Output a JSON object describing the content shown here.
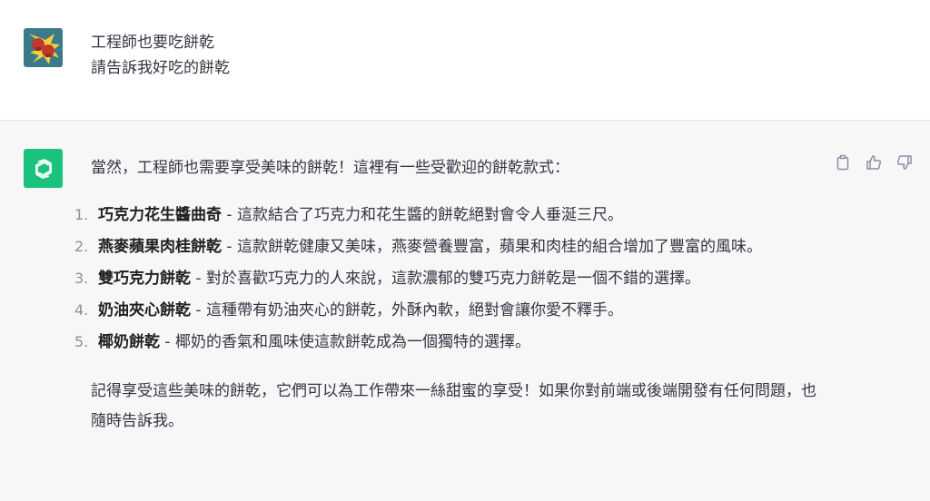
{
  "user_message": {
    "lines": [
      "工程師也要吃餅乾",
      "請告訴我好吃的餅乾"
    ]
  },
  "assistant_message": {
    "intro": "當然，工程師也需要享受美味的餅乾！這裡有一些受歡迎的餅乾款式：",
    "items": [
      {
        "num": "1.",
        "name": "巧克力花生醬曲奇",
        "desc": " - 這款結合了巧克力和花生醬的餅乾絕對會令人垂涎三尺。"
      },
      {
        "num": "2.",
        "name": "燕麥蘋果肉桂餅乾",
        "desc": " - 這款餅乾健康又美味，燕麥營養豐富，蘋果和肉桂的組合增加了豐富的風味。"
      },
      {
        "num": "3.",
        "name": "雙巧克力餅乾",
        "desc": " - 對於喜歡巧克力的人來說，這款濃郁的雙巧克力餅乾是一個不錯的選擇。"
      },
      {
        "num": "4.",
        "name": "奶油夾心餅乾",
        "desc": " - 這種帶有奶油夾心的餅乾，外酥內軟，絕對會讓你愛不釋手。"
      },
      {
        "num": "5.",
        "name": "椰奶餅乾",
        "desc": " - 椰奶的香氣和風味使這款餅乾成為一個獨特的選擇。"
      }
    ],
    "closing": "記得享受這些美味的餅乾，它們可以為工作帶來一絲甜蜜的享受！如果你對前端或後端開發有任何問題，也隨時告訴我。"
  },
  "actions": {
    "copy": "clipboard-icon",
    "thumbs_up": "thumbs-up-icon",
    "thumbs_down": "thumbs-down-icon"
  },
  "colors": {
    "gpt_avatar": "#19c37d",
    "text": "#343541",
    "assistant_bg": "#f7f7f8",
    "user_bg": "#ffffff"
  }
}
